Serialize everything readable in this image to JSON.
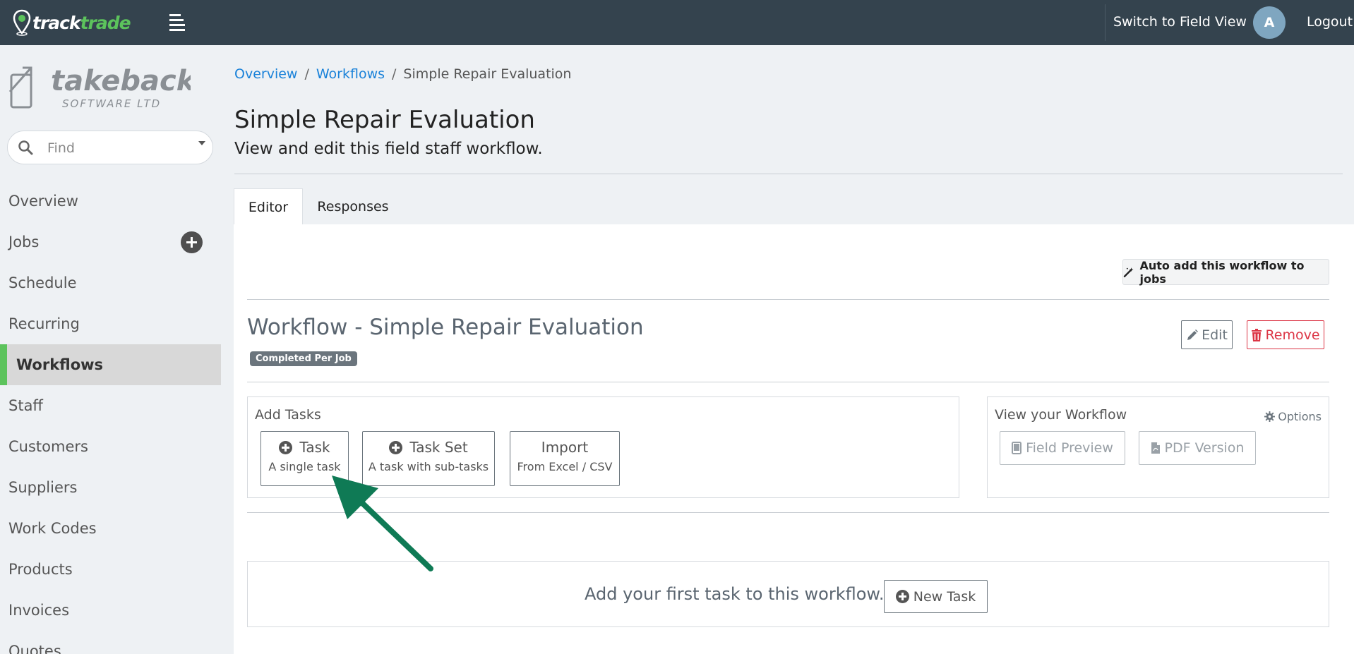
{
  "topbar": {
    "logo_part1": "track",
    "logo_part2": "trade",
    "switch_label": "Switch to Field View",
    "avatar_initial": "A",
    "logout_label": "Logout"
  },
  "brand": {
    "name": "takeback",
    "subtitle": "SOFTWARE LTD"
  },
  "search": {
    "placeholder": "Find"
  },
  "sidebar": {
    "items": [
      {
        "label": "Overview"
      },
      {
        "label": "Jobs"
      },
      {
        "label": "Schedule"
      },
      {
        "label": "Recurring"
      },
      {
        "label": "Workflows"
      },
      {
        "label": "Staff"
      },
      {
        "label": "Customers"
      },
      {
        "label": "Suppliers"
      },
      {
        "label": "Work Codes"
      },
      {
        "label": "Products"
      },
      {
        "label": "Invoices"
      },
      {
        "label": "Quotes"
      }
    ]
  },
  "breadcrumb": {
    "items": [
      "Overview",
      "Workflows",
      "Simple Repair Evaluation"
    ],
    "separator": "/"
  },
  "page": {
    "title": "Simple Repair Evaluation",
    "subtitle": "View and edit this field staff workflow."
  },
  "tabs": [
    {
      "label": "Editor",
      "active": true
    },
    {
      "label": "Responses",
      "active": false
    }
  ],
  "editor": {
    "auto_add_label": "Auto add this workflow to jobs",
    "workflow_title": "Workflow - Simple Repair Evaluation",
    "badge": "Completed Per Job",
    "edit_label": "Edit",
    "remove_label": "Remove",
    "add_tasks": {
      "label": "Add Tasks",
      "buttons": [
        {
          "title": "Task",
          "subtitle": "A single task"
        },
        {
          "title": "Task Set",
          "subtitle": "A task with sub-tasks"
        },
        {
          "title": "Import",
          "subtitle": "From Excel / CSV"
        }
      ]
    },
    "view_workflow": {
      "label": "View your Workflow",
      "options_label": "Options",
      "field_preview_label": "Field Preview",
      "pdf_label": "PDF Version"
    },
    "empty_text": "Add your first task to this workflow.",
    "new_task_label": "New Task"
  },
  "colors": {
    "topbar_bg": "#34434e",
    "accent_green": "#5cc35c",
    "link_blue": "#1a82d9",
    "danger_red": "#dc3545",
    "annotation_arrow": "#0f7a55"
  }
}
